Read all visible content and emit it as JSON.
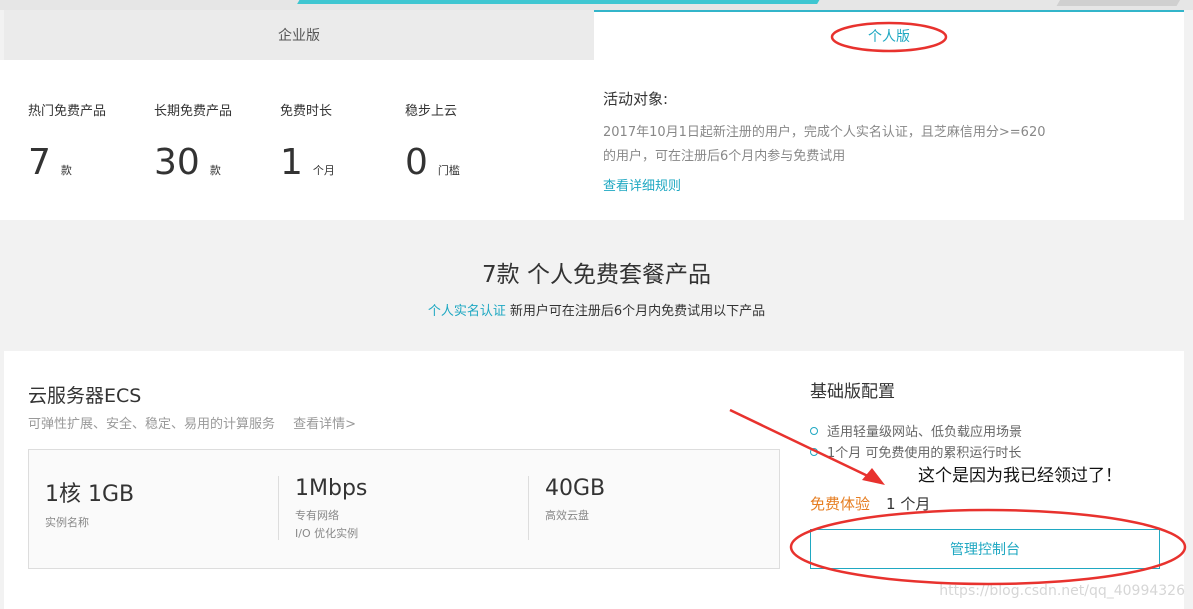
{
  "tabs": {
    "enterprise": "企业版",
    "personal": "个人版"
  },
  "stats": [
    {
      "label": "热门免费产品",
      "value": "7",
      "unit": "款"
    },
    {
      "label": "长期免费产品",
      "value": "30",
      "unit": "款"
    },
    {
      "label": "免费时长",
      "value": "1",
      "unit": "个月"
    },
    {
      "label": "稳步上云",
      "value": "0",
      "unit": "门槛"
    }
  ],
  "activity": {
    "title": "活动对象:",
    "desc_line1": "2017年10月1日起新注册的用户，完成个人实名认证，且芝麻信用分>=620",
    "desc_line2": "的用户，可在注册后6个月内参与免费试用",
    "link": "查看详细规则"
  },
  "package": {
    "title": "7款 个人免费套餐产品",
    "sub_link": "个人实名认证",
    "sub_text": "新用户可在注册后6个月内免费试用以下产品"
  },
  "product": {
    "title": "云服务器ECS",
    "desc": "可弹性扩展、安全、稳定、易用的计算服务",
    "more": "查看详情>",
    "specs": [
      {
        "value": "1核 1GB",
        "label1": "实例名称",
        "label2": ""
      },
      {
        "value": "1Mbps",
        "label1": "专有网络",
        "label2": "I/O 优化实例"
      },
      {
        "value": "40GB",
        "label1": "高效云盘",
        "label2": ""
      }
    ],
    "config_title": "基础版配置",
    "bullets": [
      "适用轻量级网站、低负载应用场景",
      "1个月 可免费使用的累积运行时长"
    ],
    "trial_label": "免费体验",
    "trial_value": "1 个月",
    "manage_button": "管理控制台"
  },
  "annotation": {
    "text": "这个是因为我已经领过了！",
    "color": "#e8322e"
  },
  "watermark": "https://blog.csdn.net/qq_40994326",
  "colors": {
    "accent": "#1fa8c2",
    "trial": "#e67e22"
  }
}
